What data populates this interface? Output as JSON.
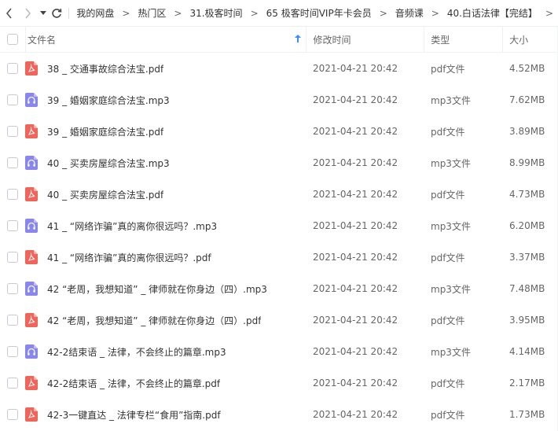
{
  "breadcrumb": [
    "我的网盘",
    "热门区",
    "31.极客时间",
    "65 极客时间VIP年卡会员",
    "音频课",
    "40.白话法律【完结】"
  ],
  "columns": {
    "name": "文件名",
    "time": "修改时间",
    "type": "类型",
    "size": "大小"
  },
  "colors": {
    "pdf": "#f0645a",
    "mp3": "#8a86f0",
    "sort_arrow": "#3b8cff"
  },
  "files": [
    {
      "name": "38 _ 交通事故综合法宝.pdf",
      "time": "2021-04-21 20:42",
      "type": "pdf文件",
      "size": "4.52MB",
      "icon": "pdf-icon"
    },
    {
      "name": "39 _ 婚姻家庭综合法宝.mp3",
      "time": "2021-04-21 20:42",
      "type": "mp3文件",
      "size": "7.62MB",
      "icon": "audio-icon"
    },
    {
      "name": "39 _ 婚姻家庭综合法宝.pdf",
      "time": "2021-04-21 20:42",
      "type": "pdf文件",
      "size": "3.89MB",
      "icon": "pdf-icon"
    },
    {
      "name": "40 _ 买卖房屋综合法宝.mp3",
      "time": "2021-04-21 20:42",
      "type": "mp3文件",
      "size": "8.99MB",
      "icon": "audio-icon"
    },
    {
      "name": "40 _ 买卖房屋综合法宝.pdf",
      "time": "2021-04-21 20:42",
      "type": "pdf文件",
      "size": "4.73MB",
      "icon": "pdf-icon"
    },
    {
      "name": "41 _ “网络诈骗”真的离你很远吗？.mp3",
      "time": "2021-04-21 20:42",
      "type": "mp3文件",
      "size": "6.20MB",
      "icon": "audio-icon"
    },
    {
      "name": "41 _ “网络诈骗”真的离你很远吗？.pdf",
      "time": "2021-04-21 20:42",
      "type": "pdf文件",
      "size": "3.37MB",
      "icon": "pdf-icon"
    },
    {
      "name": "42 “老周，我想知道” _ 律师就在你身边（四）.mp3",
      "time": "2021-04-21 20:42",
      "type": "mp3文件",
      "size": "7.48MB",
      "icon": "audio-icon"
    },
    {
      "name": "42 “老周，我想知道” _ 律师就在你身边（四）.pdf",
      "time": "2021-04-21 20:42",
      "type": "pdf文件",
      "size": "3.95MB",
      "icon": "pdf-icon"
    },
    {
      "name": "42-2结束语 _ 法律，不会终止的篇章.mp3",
      "time": "2021-04-21 20:42",
      "type": "mp3文件",
      "size": "4.14MB",
      "icon": "audio-icon"
    },
    {
      "name": "42-2结束语 _ 法律，不会终止的篇章.pdf",
      "time": "2021-04-21 20:42",
      "type": "pdf文件",
      "size": "2.17MB",
      "icon": "pdf-icon"
    },
    {
      "name": "42-3一键直达 _ 法律专栏“食用”指南.pdf",
      "time": "2021-04-21 20:42",
      "type": "pdf文件",
      "size": "1.73MB",
      "icon": "pdf-icon"
    }
  ]
}
